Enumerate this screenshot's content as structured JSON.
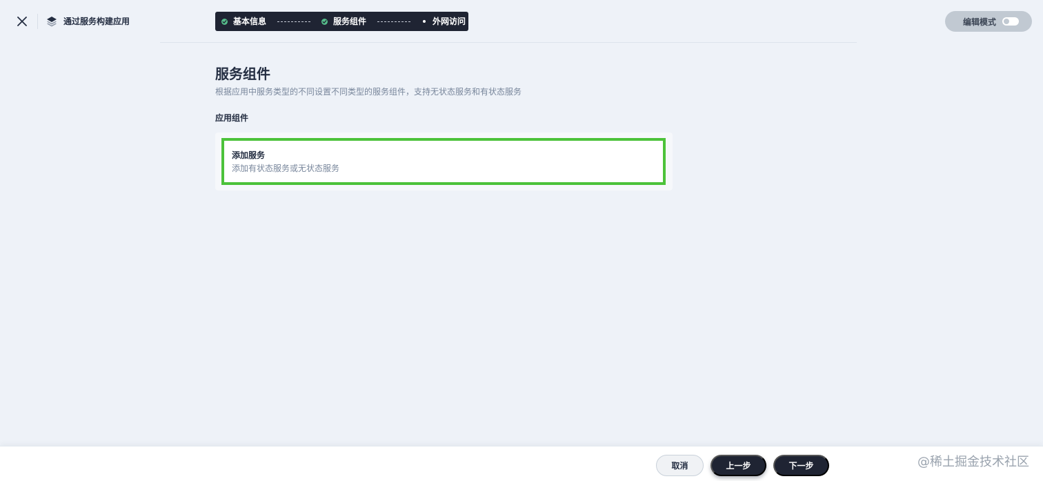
{
  "header": {
    "title": "通过服务构建应用",
    "close_icon": "close-icon",
    "app_icon": "layers-icon"
  },
  "steps": [
    {
      "label": "基本信息",
      "status": "done"
    },
    {
      "label": "服务组件",
      "status": "done"
    },
    {
      "label": "外网访问",
      "status": "pending"
    }
  ],
  "edit_mode": {
    "label": "编辑模式",
    "enabled": false
  },
  "main": {
    "title": "服务组件",
    "description": "根据应用中服务类型的不同设置不同类型的服务组件，支持无状态服务和有状态服务",
    "section_label": "应用组件",
    "add_card": {
      "title": "添加服务",
      "description": "添加有状态服务或无状态服务"
    }
  },
  "footer": {
    "cancel_label": "取消",
    "prev_label": "上一步",
    "next_label": "下一步"
  },
  "watermark": "@稀土掘金技术社区",
  "colors": {
    "accent_dark": "#1f2433",
    "success": "#55bc8a",
    "highlight": "#4cc23a",
    "background": "#eef2f8"
  }
}
